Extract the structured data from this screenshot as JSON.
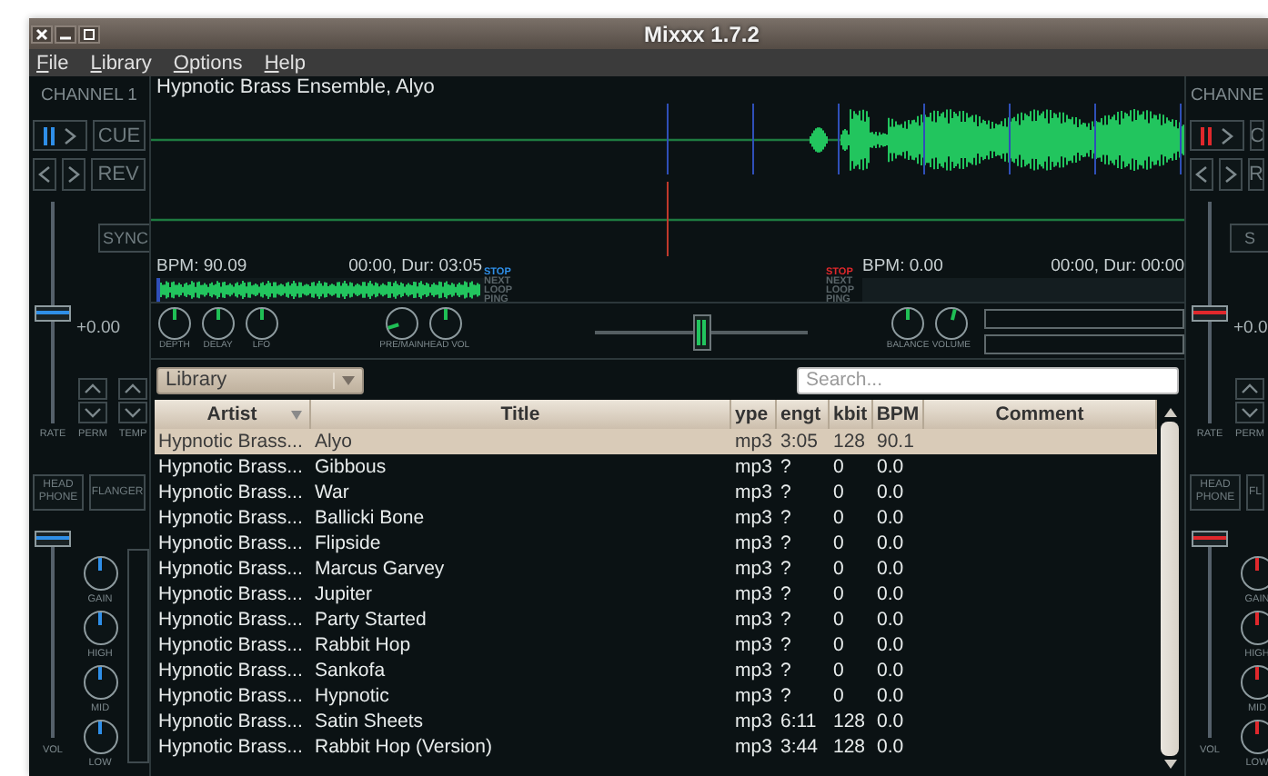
{
  "window": {
    "title": "Mixxx 1.7.2"
  },
  "menu": [
    "File",
    "Library",
    "Options",
    "Help"
  ],
  "decks": [
    {
      "label": "CHANNEL 1",
      "color": "#2f8fe8",
      "cue": "CUE",
      "rev": "REV",
      "sync": "SYNC",
      "rate": "+0.00",
      "pitch": {
        "level": 0.5
      },
      "rate_labels": [
        "RATE",
        "PERM",
        "TEMP"
      ],
      "headphone": "HEAD PHONE",
      "flanger": "FLANGER",
      "volume": {
        "level": 1
      },
      "eq": [
        {
          "label": "GAIN",
          "level": 0.5
        },
        {
          "label": "HIGH",
          "level": 0.5
        },
        {
          "label": "MID",
          "level": 0.5
        },
        {
          "label": "LOW",
          "level": 0.5
        }
      ],
      "vol_label": "VOL",
      "level_meter": true
    },
    {
      "label": "CHANNE",
      "color": "#e0282c",
      "cue": "C",
      "rev": "R",
      "sync": "S",
      "rate": "+0.0",
      "pitch": {
        "level": 0.5
      },
      "rate_labels": [
        "RATE",
        "PERM"
      ],
      "headphone": "HEAD PHONE",
      "flanger": "FL",
      "volume": {
        "level": 1
      },
      "eq": [
        {
          "label": "GAIN",
          "level": 0.5
        },
        {
          "label": "HIGH",
          "level": 0.5
        },
        {
          "label": "MID",
          "level": 0.5
        },
        {
          "label": "LOW",
          "level": 0.5
        }
      ],
      "vol_label": "VOL",
      "level_meter": false
    }
  ],
  "players": [
    {
      "track": "Hypnotic Brass Ensemble, Alyo",
      "bpm": "BPM: 90.09",
      "time": "00:00, Dur: 03:05",
      "status": [
        {
          "label": "STOP",
          "active": true
        },
        {
          "label": "NEXT",
          "active": false
        },
        {
          "label": "LOOP",
          "active": false
        },
        {
          "label": "PING",
          "active": false
        }
      ]
    },
    {
      "bpm": "BPM: 0.00",
      "time": "00:00, Dur: 00:00",
      "status": [
        {
          "label": "STOP",
          "active": true
        },
        {
          "label": "NEXT",
          "active": false
        },
        {
          "label": "LOOP",
          "active": false
        },
        {
          "label": "PING",
          "active": false
        }
      ]
    }
  ],
  "mixer": {
    "flanger_knobs": [
      {
        "label": "DEPTH",
        "level": 0.5
      },
      {
        "label": "DELAY",
        "level": 0.5
      },
      {
        "label": "LFO",
        "level": 0.5
      }
    ],
    "headphone_knobs": [
      {
        "label": "PRE/MAIN",
        "level": 0.1
      },
      {
        "label": "HEAD VOL",
        "level": 0.5
      }
    ],
    "crossfader": {
      "level": 0.5
    },
    "master_knobs": [
      {
        "label": "BALANCE",
        "level": 0.5
      },
      {
        "label": "VOLUME",
        "level": 0.55
      }
    ]
  },
  "library": {
    "source": "Library",
    "search": {
      "placeholder": "Search..."
    },
    "columns": [
      {
        "label": "Artist",
        "sorted": true
      },
      {
        "label": "Title",
        "sorted": false
      },
      {
        "label": "ype",
        "sorted": false
      },
      {
        "label": "engt",
        "sorted": false
      },
      {
        "label": "kbit",
        "sorted": false
      },
      {
        "label": "BPM",
        "sorted": false
      },
      {
        "label": "Comment",
        "sorted": false
      }
    ],
    "rows": [
      {
        "cells": [
          "Hypnotic Brass...",
          "Alyo",
          "mp3",
          "3:05",
          "128",
          "90.1"
        ],
        "selected": true
      },
      {
        "cells": [
          "Hypnotic Brass...",
          "Gibbous",
          "mp3",
          "?",
          "0",
          "0.0"
        ],
        "selected": false
      },
      {
        "cells": [
          "Hypnotic Brass...",
          "War",
          "mp3",
          "?",
          "0",
          "0.0"
        ],
        "selected": false
      },
      {
        "cells": [
          "Hypnotic Brass...",
          "Ballicki Bone",
          "mp3",
          "?",
          "0",
          "0.0"
        ],
        "selected": false
      },
      {
        "cells": [
          "Hypnotic Brass...",
          "Flipside",
          "mp3",
          "?",
          "0",
          "0.0"
        ],
        "selected": false
      },
      {
        "cells": [
          "Hypnotic Brass...",
          "Marcus Garvey",
          "mp3",
          "?",
          "0",
          "0.0"
        ],
        "selected": false
      },
      {
        "cells": [
          "Hypnotic Brass...",
          "Jupiter",
          "mp3",
          "?",
          "0",
          "0.0"
        ],
        "selected": false
      },
      {
        "cells": [
          "Hypnotic Brass...",
          "Party Started",
          "mp3",
          "?",
          "0",
          "0.0"
        ],
        "selected": false
      },
      {
        "cells": [
          "Hypnotic Brass...",
          "Rabbit Hop",
          "mp3",
          "?",
          "0",
          "0.0"
        ],
        "selected": false
      },
      {
        "cells": [
          "Hypnotic Brass...",
          "Sankofa",
          "mp3",
          "?",
          "0",
          "0.0"
        ],
        "selected": false
      },
      {
        "cells": [
          "Hypnotic Brass...",
          "Hypnotic",
          "mp3",
          "?",
          "0",
          "0.0"
        ],
        "selected": false
      },
      {
        "cells": [
          "Hypnotic Brass...",
          "Satin Sheets",
          "mp3",
          "6:11",
          "128",
          "0.0"
        ],
        "selected": false
      },
      {
        "cells": [
          "Hypnotic Brass...",
          "Rabbit Hop (Version)",
          "mp3",
          "3:44",
          "128",
          "0.0"
        ],
        "selected": false
      }
    ]
  }
}
